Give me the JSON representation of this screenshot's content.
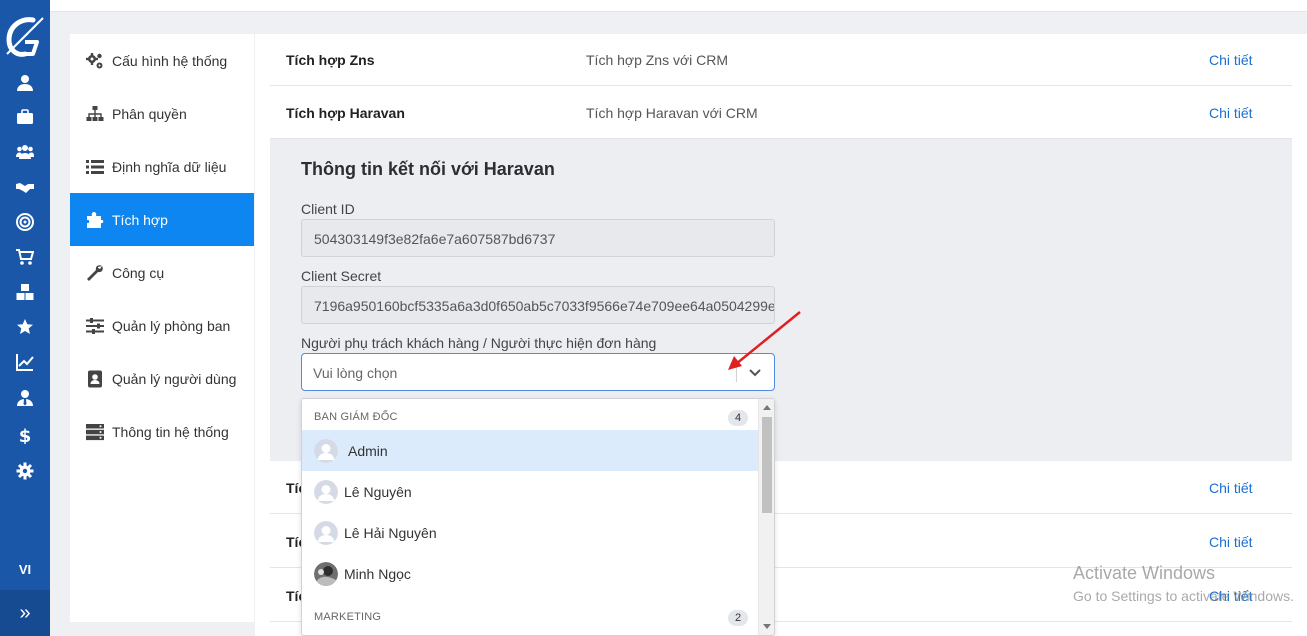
{
  "app": {
    "language": "VI",
    "brand_color": "#1a57a8",
    "accent_color": "#0d86f2",
    "link_color": "#1a6fd1"
  },
  "rail": {
    "icons": [
      "user-icon",
      "briefcase-icon",
      "users-icon",
      "handshake-icon",
      "target-icon",
      "cart-icon",
      "boxes-icon",
      "star-icon",
      "chart-line-icon",
      "user-tie-icon",
      "dollar-icon",
      "gear-icon"
    ],
    "collapse_label": "»"
  },
  "sidebar": {
    "items": [
      {
        "label": "Cấu hình hệ thống",
        "icon": "cogs-icon"
      },
      {
        "label": "Phân quyền",
        "icon": "sitemap-icon"
      },
      {
        "label": "Định nghĩa dữ liệu",
        "icon": "list-icon"
      },
      {
        "label": "Tích hợp",
        "icon": "puzzle-icon",
        "active": true
      },
      {
        "label": "Công cụ",
        "icon": "wrench-icon"
      },
      {
        "label": "Quản lý phòng ban",
        "icon": "sliders-icon"
      },
      {
        "label": "Quản lý người dùng",
        "icon": "address-book-icon"
      },
      {
        "label": "Thông tin hệ thống",
        "icon": "server-icon"
      }
    ]
  },
  "integrations": {
    "rows": [
      {
        "name": "Tích hợp Zns",
        "desc": "Tích hợp Zns với CRM",
        "link": "Chi tiết"
      },
      {
        "name": "Tích hợp Haravan",
        "desc": "Tích hợp Haravan với CRM",
        "link": "Chi tiết"
      }
    ],
    "rows_below": [
      {
        "name": "Tíc",
        "link": "Chi tiết"
      },
      {
        "name": "Tíc",
        "link": "Chi tiết"
      },
      {
        "name": "Tíc",
        "link": "Chi tiết"
      }
    ]
  },
  "haravan": {
    "heading": "Thông tin kết nối với Haravan",
    "client_id_label": "Client ID",
    "client_id_value": "504303149f3e82fa6e7a607587bd6737",
    "client_secret_label": "Client Secret",
    "client_secret_value": "7196a950160bcf5335a6a3d0f650ab5c7033f9566e74e709ee64a0504299e",
    "assignee_label": "Người phụ trách khách hàng / Người thực hiện đơn hàng",
    "assignee_placeholder": "Vui lòng chọn"
  },
  "dropdown": {
    "groups": [
      {
        "name": "BAN GIÁM ĐỐC",
        "count": "4",
        "options": [
          {
            "label": "Admin",
            "highlighted": true
          },
          {
            "label": "Lê Nguyên"
          },
          {
            "label": "Lê Hải Nguyên"
          },
          {
            "label": "Minh Ngọc",
            "photo": true
          }
        ]
      },
      {
        "name": "MARKETING",
        "count": "2"
      }
    ]
  },
  "watermark": {
    "line1": "Activate Windows",
    "line2": "Go to Settings to activate Windows."
  }
}
